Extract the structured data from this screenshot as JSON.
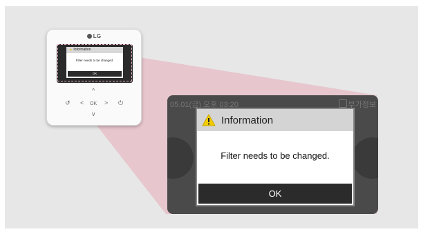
{
  "remote": {
    "brand": "LG",
    "mini_dialog": {
      "title": "Information",
      "message": "Filter needs to be changed.",
      "ok_label": "OK"
    },
    "buttons": {
      "up": "^",
      "left": "<",
      "ok": "OK",
      "right": ">",
      "down": "v",
      "back": "↺",
      "power": "⏻"
    }
  },
  "screen": {
    "status_left": "05.01(금) 오후 03:20",
    "status_right": "부가정보"
  },
  "dialog": {
    "title": "Information",
    "message": "Filter needs to be changed.",
    "ok_label": "OK",
    "warning_color": "#f2cc00"
  },
  "icons": [
    "lg-logo-icon",
    "warning-icon",
    "back-icon",
    "power-icon",
    "info-icon"
  ]
}
